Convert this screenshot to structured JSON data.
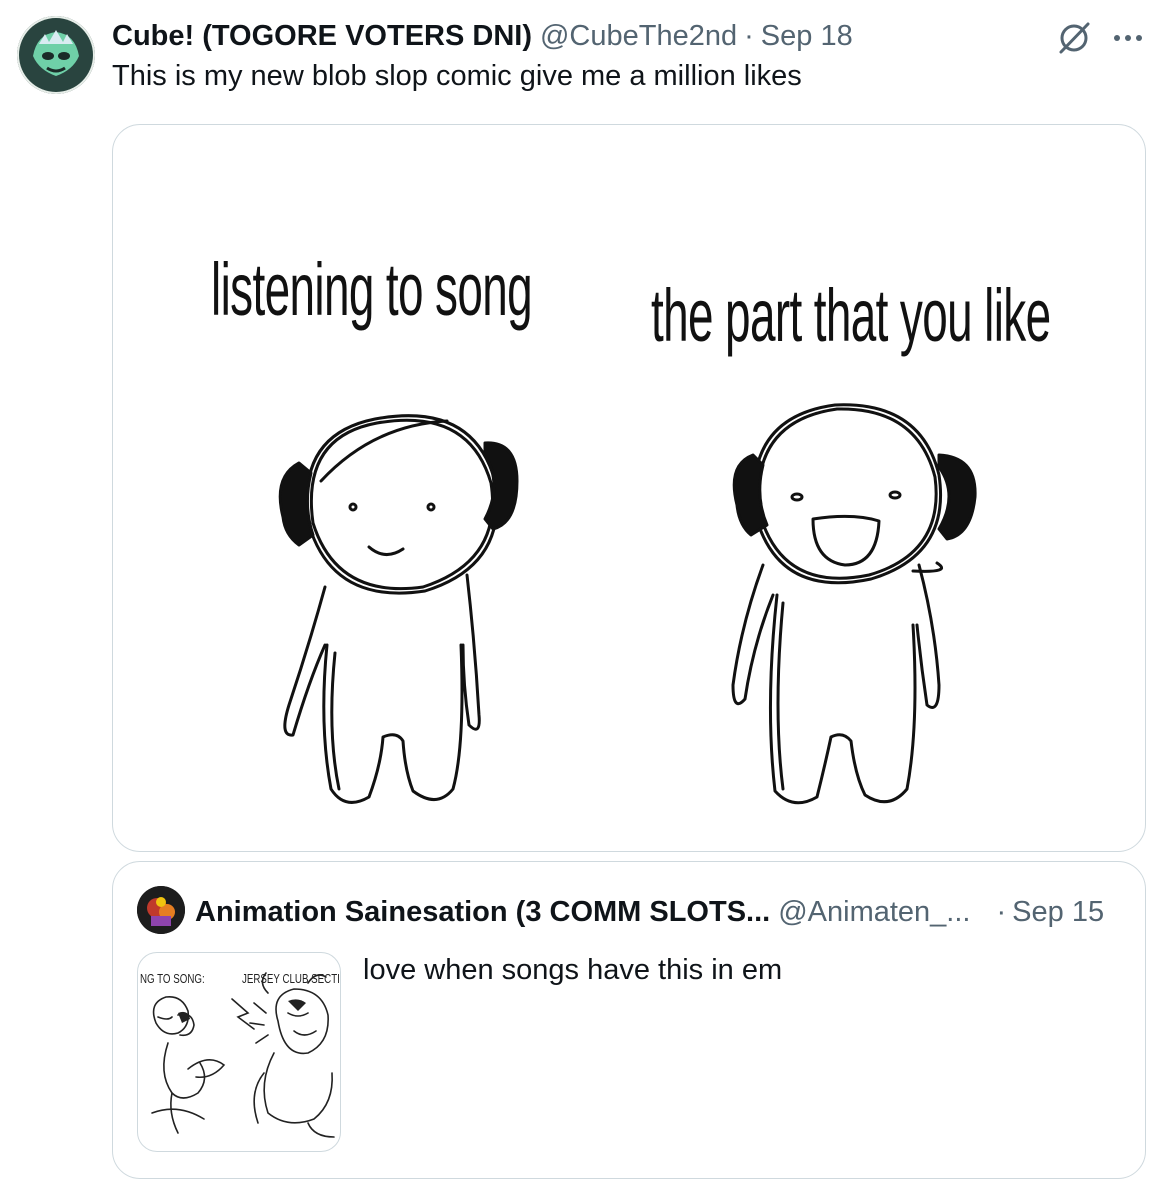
{
  "tweet": {
    "author_name": "Cube! (TOGORE VOTERS DNI)",
    "handle": "@CubeThe2nd",
    "separator": "·",
    "time": "Sep 18",
    "text": "This is my new blob slop comic give me a million likes",
    "more_label": "···",
    "media": {
      "caption_left": "listening to song",
      "caption_right": "the part that you like"
    }
  },
  "quote": {
    "author_name": "Animation Sainesation (3 COMM SLOTS...",
    "handle": "@Animaten_...",
    "separator": "·",
    "time": "Sep 15",
    "text": "love when songs have this in em",
    "thumb": {
      "caption_left": "NG TO SONG:",
      "caption_right": "JERSEY CLUB SECTION/V"
    }
  },
  "colors": {
    "text_primary": "#0f1419",
    "text_secondary": "#536471",
    "border": "#cfd9de"
  },
  "icons": {
    "grok": "grok-slash-icon",
    "more": "more-horizontal-icon"
  }
}
